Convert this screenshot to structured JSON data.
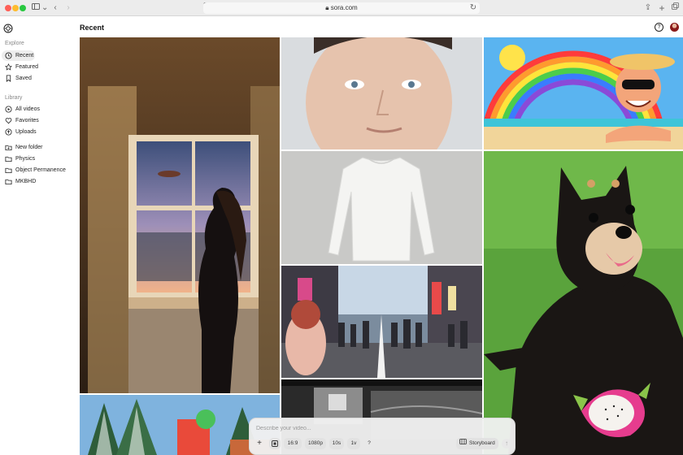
{
  "browser": {
    "url": "sora.com"
  },
  "sidebar": {
    "explore_label": "Explore",
    "library_label": "Library",
    "explore_items": [
      {
        "label": "Recent",
        "icon": "clock-icon"
      },
      {
        "label": "Featured",
        "icon": "star-icon"
      },
      {
        "label": "Saved",
        "icon": "bookmark-icon"
      }
    ],
    "library_items": [
      {
        "label": "All videos",
        "icon": "video-grid-icon"
      },
      {
        "label": "Favorites",
        "icon": "heart-icon"
      },
      {
        "label": "Uploads",
        "icon": "upload-icon"
      }
    ],
    "folders": [
      {
        "label": "New folder",
        "icon": "folder-plus-icon"
      },
      {
        "label": "Physics",
        "icon": "folder-icon"
      },
      {
        "label": "Object Permanence",
        "icon": "folder-icon"
      },
      {
        "label": "MKBHD",
        "icon": "folder-icon"
      }
    ]
  },
  "header": {
    "title": "Recent",
    "help_label": "?"
  },
  "prompt_bar": {
    "placeholder": "Describe your video...",
    "add_label": "+",
    "aspect_ratio": "16:9",
    "resolution": "1080p",
    "duration": "10s",
    "variations": "1v",
    "help": "?",
    "storyboard_label": "Storyboard",
    "send_label": "↑"
  },
  "accent": {
    "active_nav_bg": "#ededed",
    "traffic_red": "#ff5f57",
    "traffic_yellow": "#febc2e",
    "traffic_green": "#28c840"
  }
}
